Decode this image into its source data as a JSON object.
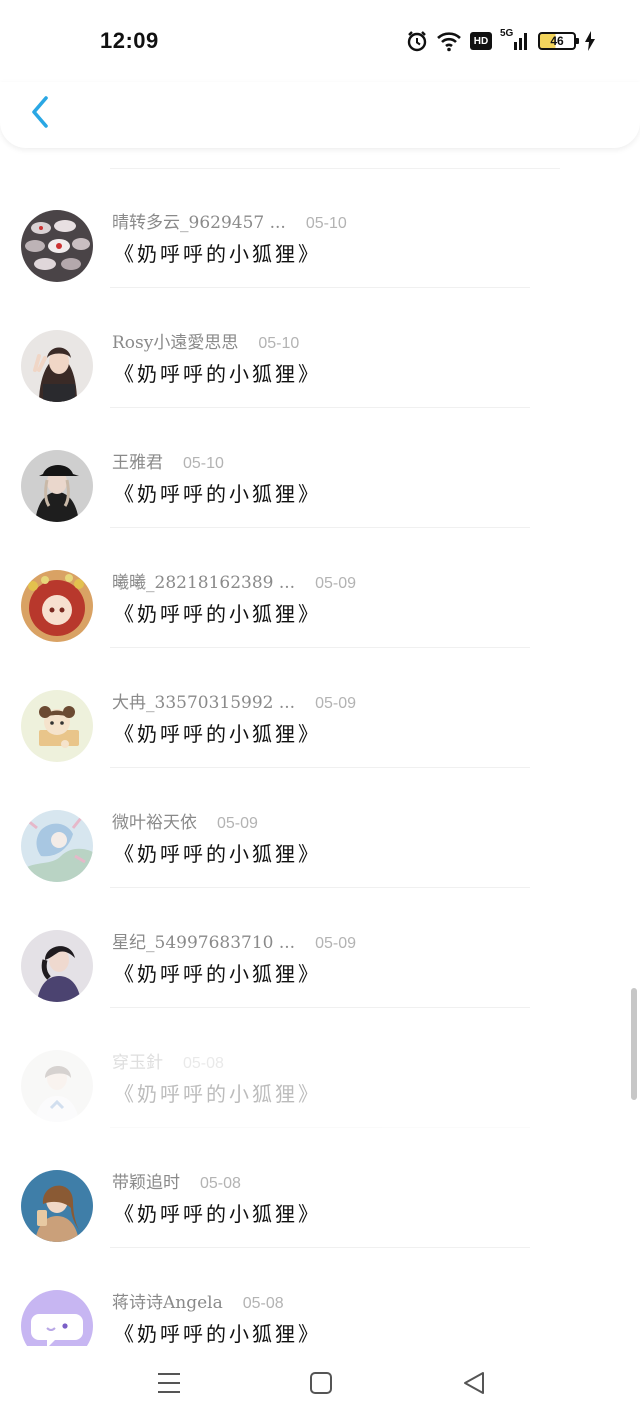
{
  "status_bar": {
    "time": "12:09",
    "icons": [
      "alarm-icon",
      "wifi-icon",
      "hd-icon",
      "signal-5g-icon",
      "battery-icon",
      "charging-icon"
    ],
    "hd_label": "HD",
    "network_label": "5G",
    "battery_level": "46"
  },
  "header": {
    "back_icon": "chevron-left-icon",
    "accent_color": "#2aa7e4"
  },
  "comments": [
    {
      "name": "晴转多云_9629457 ...",
      "date": "05-10",
      "title": "《奶呼呼的小狐狸》"
    },
    {
      "name": "Rosy小遠愛思思",
      "date": "05-10",
      "title": "《奶呼呼的小狐狸》"
    },
    {
      "name": "王雅君",
      "date": "05-10",
      "title": "《奶呼呼的小狐狸》"
    },
    {
      "name": "曦曦_28218162389 ...",
      "date": "05-09",
      "title": "《奶呼呼的小狐狸》"
    },
    {
      "name": "大冉_33570315992 ...",
      "date": "05-09",
      "title": "《奶呼呼的小狐狸》"
    },
    {
      "name": "微叶裕天依",
      "date": "05-09",
      "title": "《奶呼呼的小狐狸》"
    },
    {
      "name": "星纪_54997683710 ...",
      "date": "05-09",
      "title": "《奶呼呼的小狐狸》"
    },
    {
      "name": "穿玉針",
      "date": "05-08",
      "title": "《奶呼呼的小狐狸》"
    },
    {
      "name": "带颖追时",
      "date": "05-08",
      "title": "《奶呼呼的小狐狸》"
    },
    {
      "name": "蒋诗诗Angela",
      "date": "05-08",
      "title": "《奶呼呼的小狐狸》"
    }
  ],
  "nav_bar": {
    "icons": [
      "menu-icon",
      "home-square-icon",
      "back-triangle-icon"
    ]
  }
}
